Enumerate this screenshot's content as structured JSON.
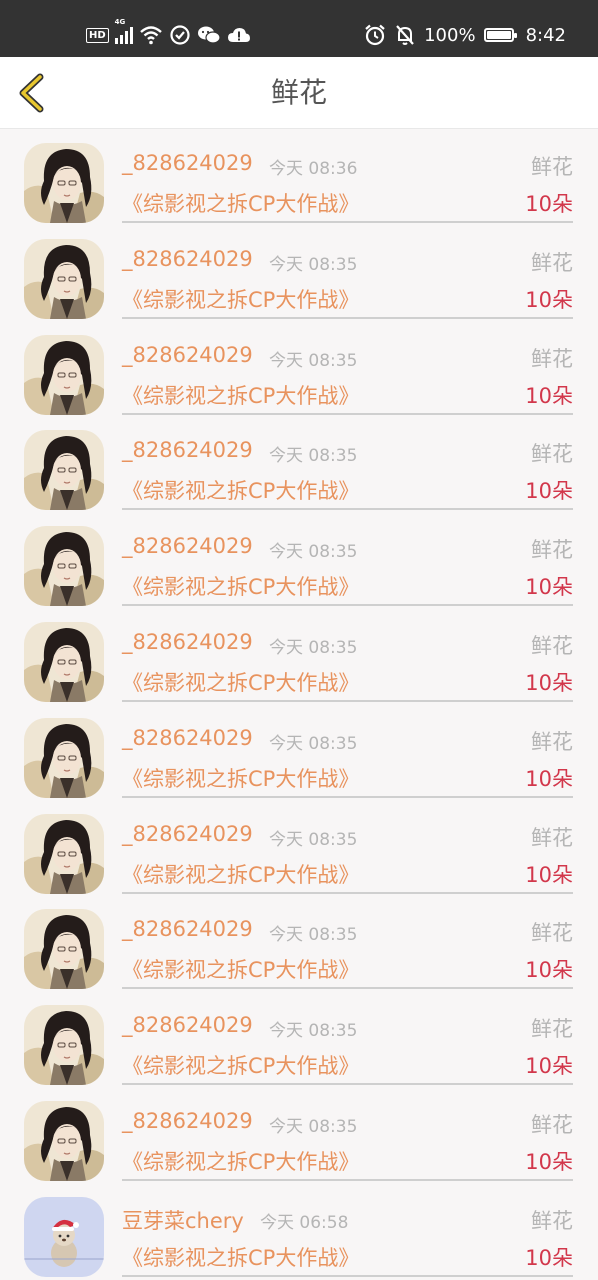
{
  "status_bar": {
    "hd": "HD",
    "network": "4G",
    "battery": "100%",
    "battery_level": 1.0,
    "time": "8:42",
    "icons": [
      "hd-icon",
      "signal-icon",
      "wifi-icon",
      "sync-icon",
      "wechat-icon",
      "cloud-alert-icon",
      "alarm-icon",
      "bell-off-icon",
      "battery-icon"
    ]
  },
  "header": {
    "title": "鲜花",
    "back_icon": "chevron-left-icon",
    "accent_color": "#e8c72f"
  },
  "colors": {
    "name": "#e8935e",
    "muted": "#b5b5b5",
    "amount": "#d2374b"
  },
  "items": [
    {
      "name": "_828624029",
      "time": "今天 08:36",
      "type": "鲜花",
      "book": "《综影视之拆CP大作战》",
      "amount": "10朵",
      "avatar": "avatar-character"
    },
    {
      "name": "_828624029",
      "time": "今天 08:35",
      "type": "鲜花",
      "book": "《综影视之拆CP大作战》",
      "amount": "10朵",
      "avatar": "avatar-character"
    },
    {
      "name": "_828624029",
      "time": "今天 08:35",
      "type": "鲜花",
      "book": "《综影视之拆CP大作战》",
      "amount": "10朵",
      "avatar": "avatar-character"
    },
    {
      "name": "_828624029",
      "time": "今天 08:35",
      "type": "鲜花",
      "book": "《综影视之拆CP大作战》",
      "amount": "10朵",
      "avatar": "avatar-character"
    },
    {
      "name": "_828624029",
      "time": "今天 08:35",
      "type": "鲜花",
      "book": "《综影视之拆CP大作战》",
      "amount": "10朵",
      "avatar": "avatar-character"
    },
    {
      "name": "_828624029",
      "time": "今天 08:35",
      "type": "鲜花",
      "book": "《综影视之拆CP大作战》",
      "amount": "10朵",
      "avatar": "avatar-character"
    },
    {
      "name": "_828624029",
      "time": "今天 08:35",
      "type": "鲜花",
      "book": "《综影视之拆CP大作战》",
      "amount": "10朵",
      "avatar": "avatar-character"
    },
    {
      "name": "_828624029",
      "time": "今天 08:35",
      "type": "鲜花",
      "book": "《综影视之拆CP大作战》",
      "amount": "10朵",
      "avatar": "avatar-character"
    },
    {
      "name": "_828624029",
      "time": "今天 08:35",
      "type": "鲜花",
      "book": "《综影视之拆CP大作战》",
      "amount": "10朵",
      "avatar": "avatar-character"
    },
    {
      "name": "_828624029",
      "time": "今天 08:35",
      "type": "鲜花",
      "book": "《综影视之拆CP大作战》",
      "amount": "10朵",
      "avatar": "avatar-character"
    },
    {
      "name": "_828624029",
      "time": "今天 08:35",
      "type": "鲜花",
      "book": "《综影视之拆CP大作战》",
      "amount": "10朵",
      "avatar": "avatar-character"
    },
    {
      "name": "豆芽菜chery",
      "time": "今天 06:58",
      "type": "鲜花",
      "book": "《综影视之拆CP大作战》",
      "amount": "10朵",
      "avatar": "avatar-bear"
    }
  ]
}
